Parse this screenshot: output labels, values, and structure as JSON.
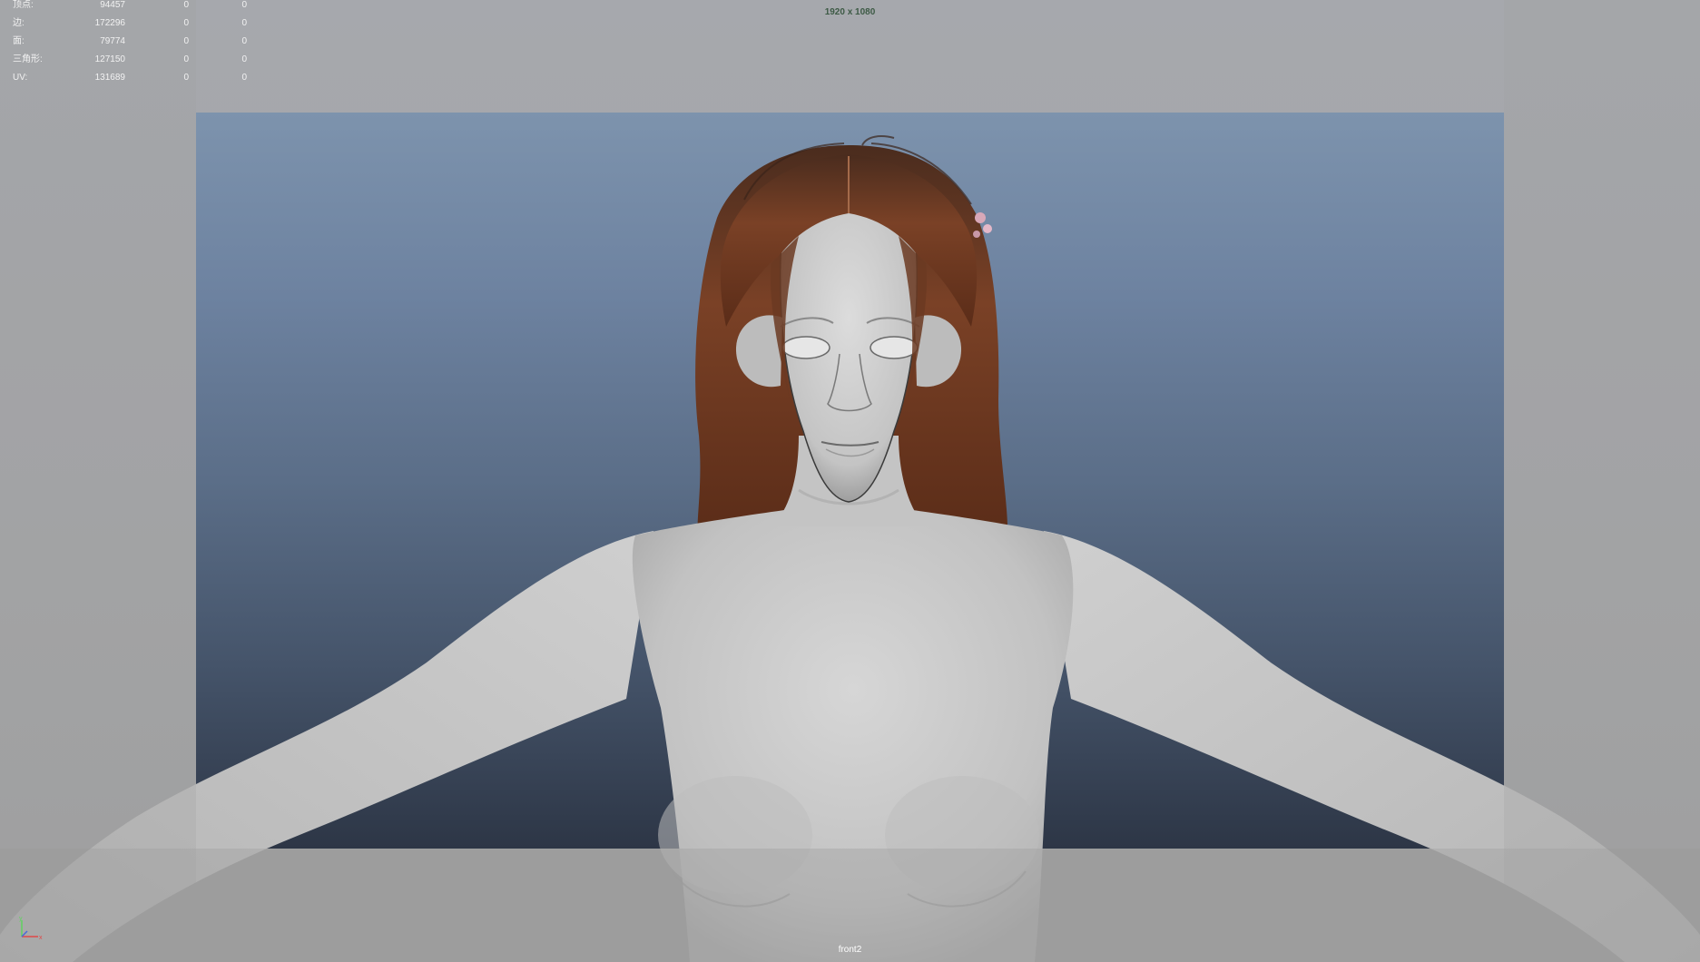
{
  "hud": {
    "polycount": [
      {
        "label": "顶点:",
        "v1": "94457",
        "v2": "0",
        "v3": "0"
      },
      {
        "label": "边:",
        "v1": "172296",
        "v2": "0",
        "v3": "0"
      },
      {
        "label": "面:",
        "v1": "79774",
        "v2": "0",
        "v3": "0"
      },
      {
        "label": "三角形:",
        "v1": "127150",
        "v2": "0",
        "v3": "0"
      },
      {
        "label": "UV:",
        "v1": "131689",
        "v2": "0",
        "v3": "0"
      }
    ],
    "resolution": "1920 x 1080",
    "camera": "front2"
  },
  "axis": {
    "x": "x",
    "y": "y"
  },
  "colors": {
    "gate_top": "#7d93ad",
    "gate_bottom": "#2d3646",
    "skin": "#c8c8c8",
    "hair": "#6b3a22",
    "resolution_text": "#3d5a45"
  }
}
